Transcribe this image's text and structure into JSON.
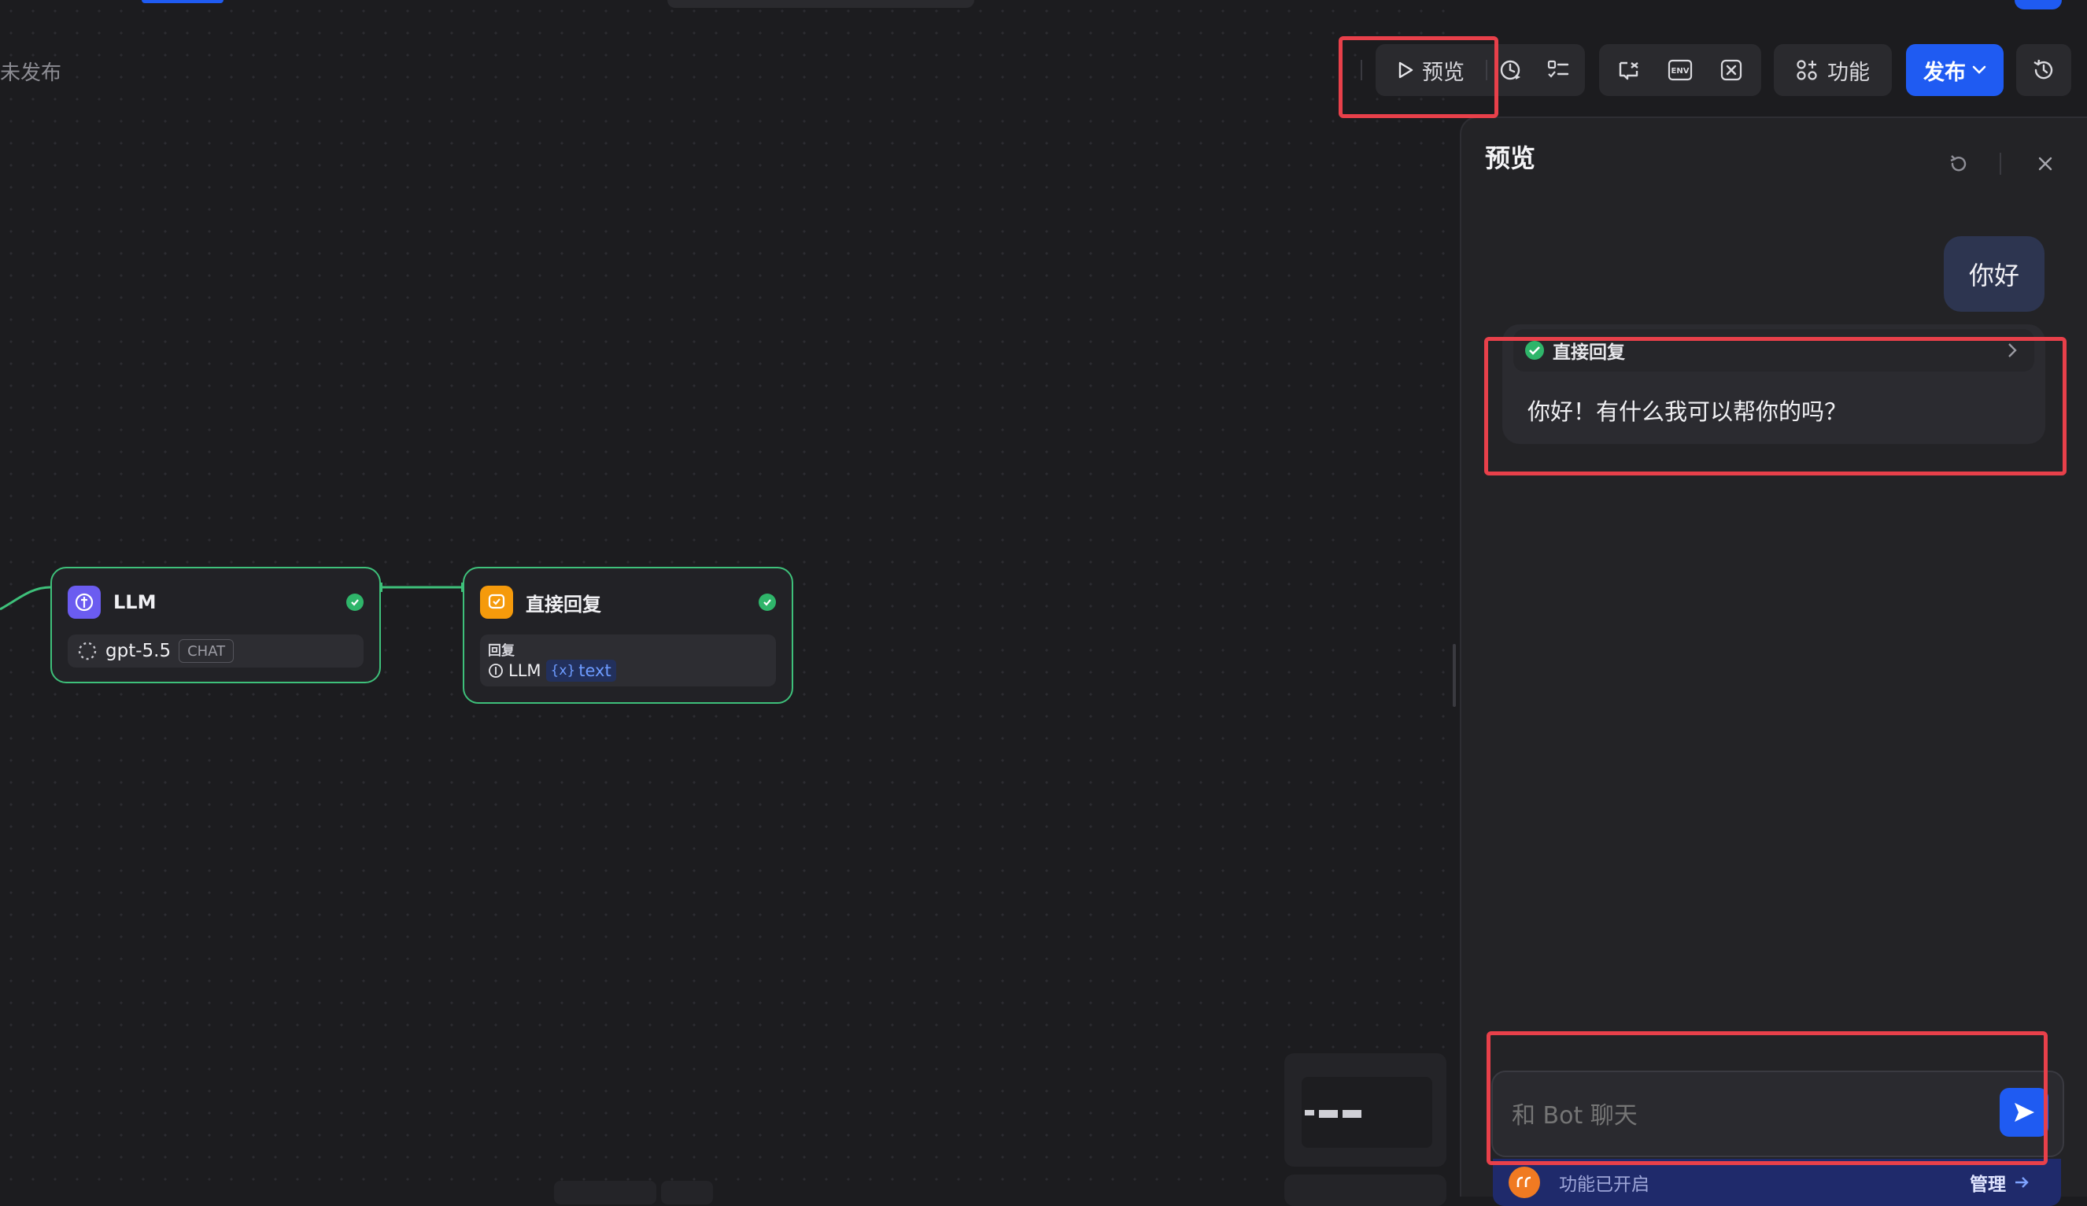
{
  "header": {
    "status_text": "未发布"
  },
  "toolbar": {
    "preview_label": "预览",
    "features_label": "功能",
    "publish_label": "发布"
  },
  "nodes": {
    "llm": {
      "title": "LLM",
      "model": "gpt-5.5",
      "mode_chip": "CHAT"
    },
    "reply": {
      "title": "直接回复",
      "field_label": "回复",
      "source_node": "LLM",
      "var_prefix": "{x}",
      "var_name": "text"
    }
  },
  "preview_panel": {
    "title": "预览",
    "user_message": "你好",
    "bot_step_label": "直接回复",
    "bot_reply": "你好！有什么我可以帮你的吗？",
    "input_placeholder": "和 Bot 聊天",
    "feature_status": "功能已开启",
    "manage_label": "管理"
  },
  "colors": {
    "accent": "#1f5bf2",
    "success": "#2fb56a",
    "node_border": "#3ec07a",
    "highlight": "#e8404a",
    "llm_icon": "#6b5cf0",
    "reply_icon": "#f59a0b"
  }
}
